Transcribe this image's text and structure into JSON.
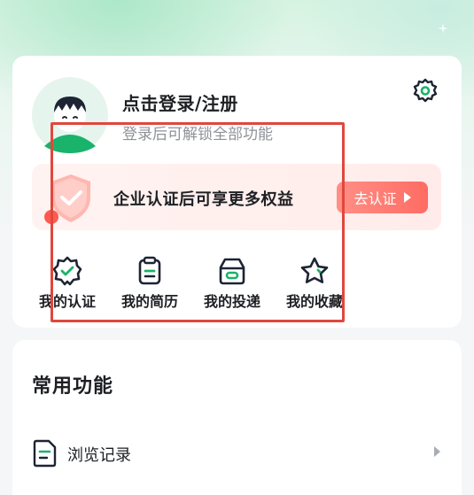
{
  "colors": {
    "accent_green": "#19b36b",
    "brand_red": "#ff6c63",
    "icon_dark": "#1d2433",
    "highlight_box": "#e0473d"
  },
  "profile": {
    "login_title": "点击登录/注册",
    "login_subtitle": "登录后可解锁全部功能",
    "avatar_icon": "default-avatar-icon",
    "settings_icon": "gear-icon"
  },
  "certification_banner": {
    "text": "企业认证后可享更多权益",
    "button_label": "去认证",
    "icon": "shield-check-icon"
  },
  "quick_actions": [
    {
      "label": "我的认证",
      "icon": "badge-check-icon"
    },
    {
      "label": "我的简历",
      "icon": "clipboard-icon"
    },
    {
      "label": "我的投递",
      "icon": "box-icon"
    },
    {
      "label": "我的收藏",
      "icon": "star-icon"
    }
  ],
  "common_features": {
    "title": "常用功能",
    "items": [
      {
        "label": "浏览记录",
        "icon": "document-icon"
      }
    ]
  }
}
